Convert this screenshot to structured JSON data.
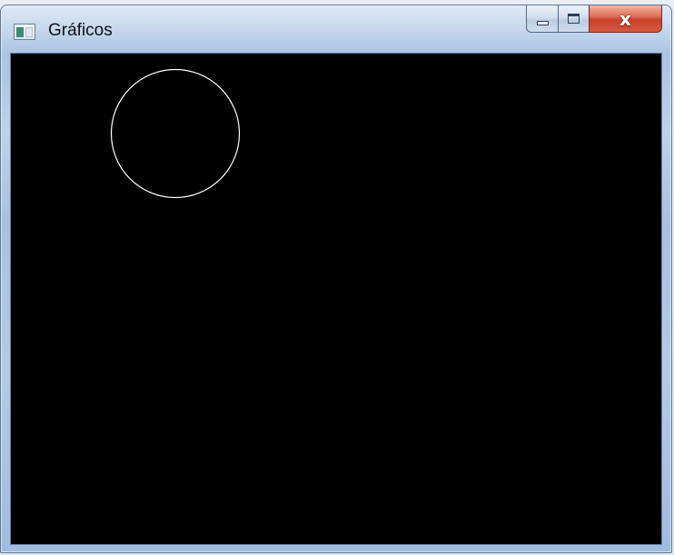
{
  "window": {
    "title": "Gráficos",
    "caption_buttons": {
      "minimize_icon": "minimize-icon",
      "maximize_icon": "maximize-icon",
      "close_glyph": "x"
    }
  },
  "canvas": {
    "background_color": "#000000",
    "stroke_color": "#ffffff",
    "shapes": [
      {
        "type": "circle",
        "name": "drawn-circle"
      }
    ]
  }
}
